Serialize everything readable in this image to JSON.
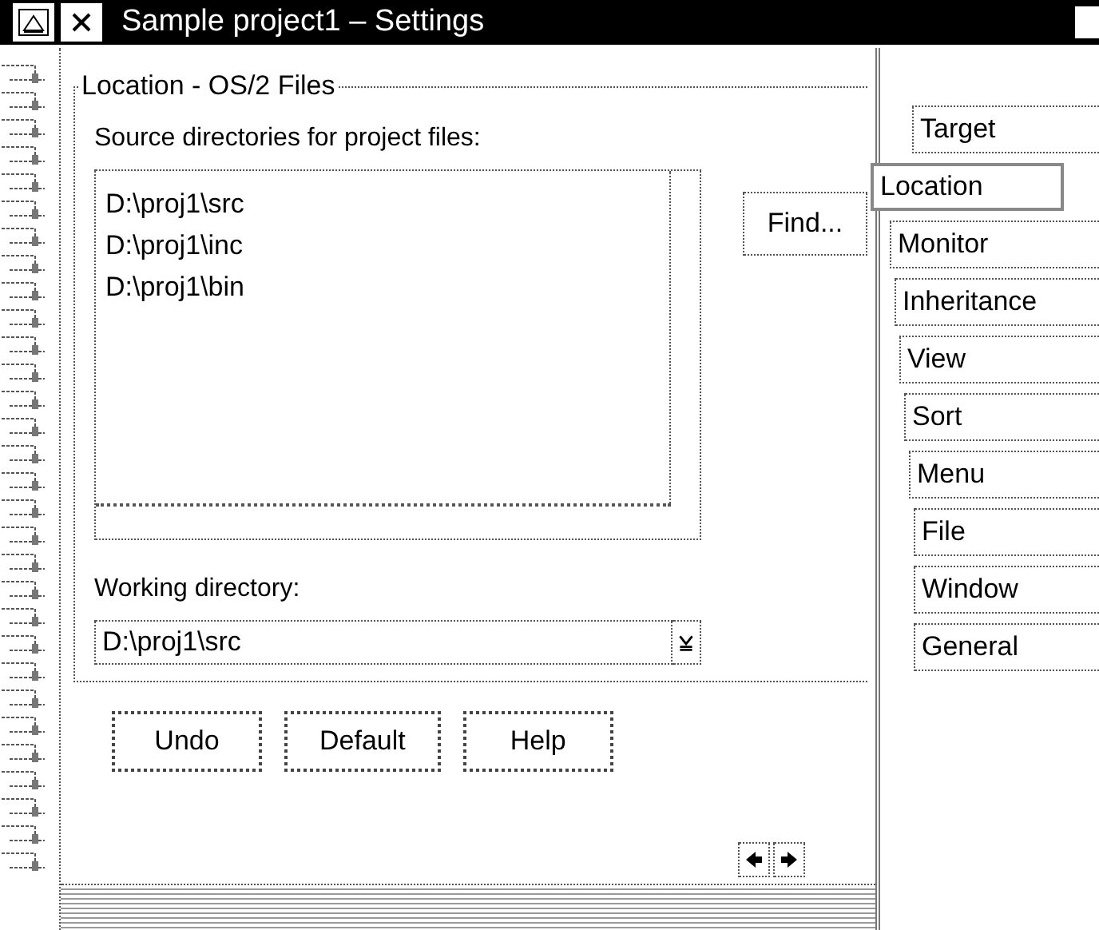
{
  "window": {
    "title": "Sample project1 – Settings"
  },
  "page": {
    "group_title": "Location - OS/2 Files",
    "source_label": "Source directories for project files:",
    "source_list": [
      "D:\\proj1\\src",
      "D:\\proj1\\inc",
      "D:\\proj1\\bin"
    ],
    "find_button": "Find...",
    "working_label": "Working directory:",
    "working_value": "D:\\proj1\\src"
  },
  "buttons": [
    "Undo",
    "Default",
    "Help"
  ],
  "tabs": [
    {
      "label": "Target",
      "selected": false
    },
    {
      "label": "Location",
      "selected": true
    },
    {
      "label": "Monitor",
      "selected": false
    },
    {
      "label": "Inheritance",
      "selected": false
    },
    {
      "label": "View",
      "selected": false
    },
    {
      "label": "Sort",
      "selected": false
    },
    {
      "label": "Menu",
      "selected": false
    },
    {
      "label": "File",
      "selected": false
    },
    {
      "label": "Window",
      "selected": false
    },
    {
      "label": "General",
      "selected": false
    }
  ]
}
